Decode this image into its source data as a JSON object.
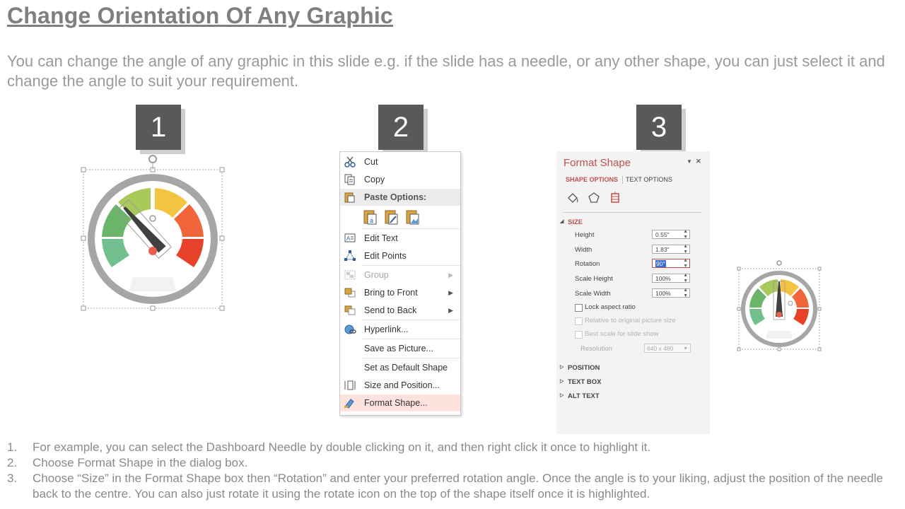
{
  "title": "Change Orientation Of Any Graphic",
  "subtitle": "You can change the angle of any graphic in this slide e.g. if the slide has a needle, or any other shape, you can just select it and change the angle to suit your requirement.",
  "badges": [
    "1",
    "2",
    "3"
  ],
  "context_menu": {
    "items": [
      {
        "label": "Cut",
        "icon": "scissors-icon"
      },
      {
        "label": "Copy",
        "icon": "copy-icon"
      },
      {
        "label": "Paste Options:",
        "icon": "paste-icon"
      },
      {
        "label": "Edit Text",
        "icon": "edit-text-icon"
      },
      {
        "label": "Edit Points",
        "icon": "edit-points-icon"
      },
      {
        "label": "Group",
        "icon": "group-icon"
      },
      {
        "label": "Bring to Front",
        "icon": "bring-to-front-icon"
      },
      {
        "label": "Send to Back",
        "icon": "send-to-back-icon"
      },
      {
        "label": "Hyperlink...",
        "icon": "hyperlink-icon"
      },
      {
        "label": "Save as Picture..."
      },
      {
        "label": "Set as Default Shape"
      },
      {
        "label": "Size and Position...",
        "icon": "size-position-icon"
      },
      {
        "label": "Format Shape...",
        "icon": "format-shape-icon"
      }
    ]
  },
  "format_pane": {
    "title": "Format Shape",
    "close": "×",
    "pin": "▼",
    "tab_shape": "SHAPE OPTIONS",
    "tab_text": "TEXT OPTIONS",
    "section_size": "SIZE",
    "height_label": "Height",
    "height_value": "0.55\"",
    "width_label": "Width",
    "width_value": "1.83\"",
    "rotation_label": "Rotation",
    "rotation_value": "90°",
    "scale_height_label": "Scale Height",
    "scale_height_value": "100%",
    "scale_width_label": "Scale Width",
    "scale_width_value": "100%",
    "lock_aspect": "Lock aspect ratio",
    "relative_original": "Relative to original picture size",
    "best_scale": "Best scale for slide show",
    "resolution_label": "Resolution",
    "resolution_value": "640 x 480",
    "section_position": "POSITION",
    "section_textbox": "TEXT BOX",
    "section_alttext": "ALT TEXT"
  },
  "steps": [
    {
      "num": "1.",
      "text": "For example, you can select the Dashboard Needle by double clicking on it, and then right click it once to highlight it."
    },
    {
      "num": "2.",
      "text": "Choose Format Shape in the dialog box."
    },
    {
      "num": "3.",
      "text": "Choose “Size” in the Format Shape box then “Rotation” and enter your preferred rotation angle. Once the angle is to your liking, adjust the position of the needle back to the centre. You can also just rotate it using the rotate icon on the top of the shape itself once it is highlighted."
    }
  ],
  "colors": {
    "accent": "#c0504d",
    "badge": "#595959",
    "gauge_ring": "#a6a6a6",
    "needle": "#404040",
    "needle_dot": "#e8604c",
    "seg_red": "#e8412a",
    "seg_orange": "#f0663a",
    "seg_yellow": "#f5c342",
    "seg_lightgreen": "#a9c95a",
    "seg_green": "#6ab56a",
    "seg_teal": "#72c08e"
  }
}
